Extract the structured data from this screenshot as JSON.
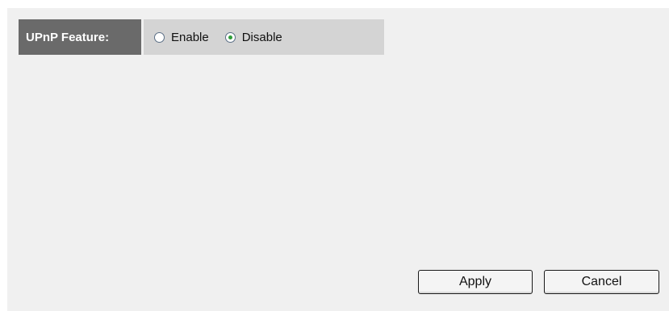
{
  "upnp": {
    "label": "UPnP Feature:",
    "options": [
      {
        "label": "Enable",
        "selected": false
      },
      {
        "label": "Disable",
        "selected": true
      }
    ]
  },
  "buttons": {
    "apply_label": "Apply",
    "cancel_label": "Cancel"
  },
  "colors": {
    "label_bg": "#6a6a6a",
    "options_bg": "#d4d4d4",
    "panel_bg": "#f0f0f0",
    "radio_selected": "#2f9e3a"
  }
}
